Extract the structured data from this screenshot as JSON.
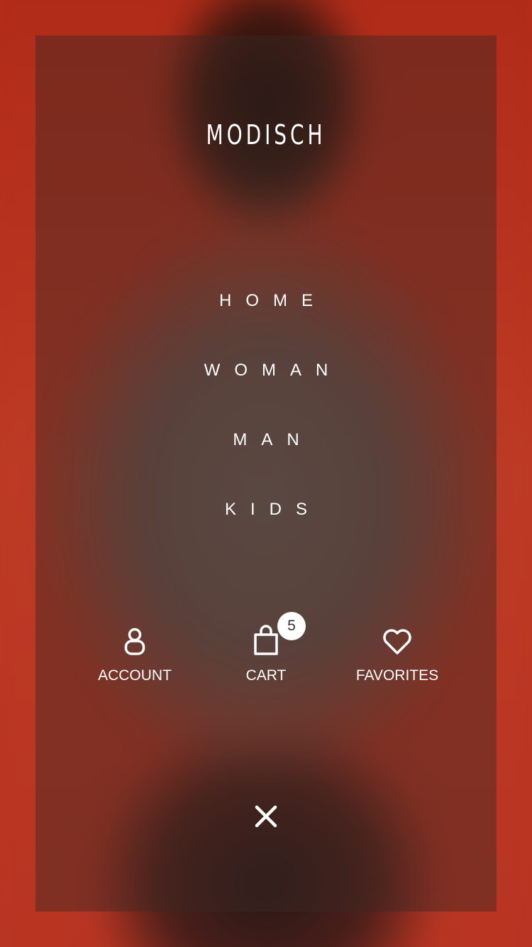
{
  "brand": {
    "logo": "MODISCH"
  },
  "nav": {
    "items": [
      {
        "label": "HOME"
      },
      {
        "label": "WOMAN"
      },
      {
        "label": "MAN"
      },
      {
        "label": "KIDS"
      }
    ]
  },
  "actions": {
    "account": {
      "label": "ACCOUNT",
      "icon": "account-icon"
    },
    "cart": {
      "label": "CART",
      "icon": "shopping-bag-icon",
      "badge": "5"
    },
    "favorites": {
      "label": "FAVORITES",
      "icon": "heart-icon"
    }
  },
  "close": {
    "icon": "close-icon"
  },
  "colors": {
    "background": "#b83220",
    "overlay": "rgba(60,40,36,0.45)",
    "text": "#ffffff",
    "badge_bg": "#ffffff",
    "badge_text": "#333333"
  }
}
